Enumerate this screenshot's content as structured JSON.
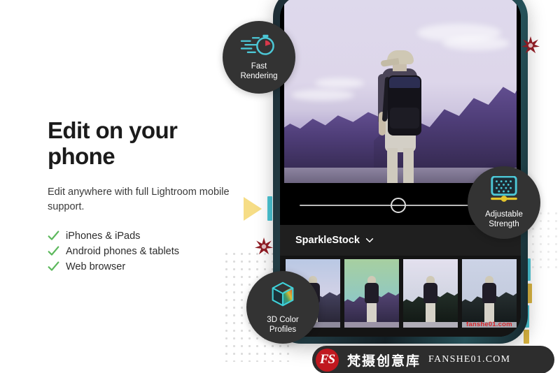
{
  "page": {
    "background_color": "#ffffff",
    "accent_teal": "#4cc7d6",
    "accent_yellow": "#f6dd86",
    "accent_red": "#8c1b23",
    "check_green": "#5cb85c",
    "badge_bg": "#333333"
  },
  "left_panel": {
    "headline": "Edit on your phone",
    "subhead": "Edit anywhere with full Lightroom mobile support.",
    "features": [
      {
        "icon": "check-icon",
        "label": "iPhones & iPads"
      },
      {
        "icon": "check-icon",
        "label": "Android phones & tablets"
      },
      {
        "icon": "check-icon",
        "label": "Web browser"
      }
    ]
  },
  "badges": [
    {
      "id": "fast-rendering",
      "icon": "stopwatch-speed-icon",
      "label": "Fast\nRendering"
    },
    {
      "id": "adjustable-strength",
      "icon": "grid-slider-icon",
      "label": "Adjustable\nStrength"
    },
    {
      "id": "3d-color-profiles",
      "icon": "color-cube-icon",
      "label": "3D Color\nProfiles"
    }
  ],
  "phone": {
    "photo": {
      "alt": "hiker-with-backpack-photo",
      "sky_color": "#ded9ec",
      "forest_color": "#4e3d77"
    },
    "slider": {
      "icon": "slider-handle-icon",
      "value_percent": 50
    },
    "preset_bar": {
      "title": "SparkleStock",
      "chevron_icon": "chevron-down-icon"
    },
    "thumbnails": [
      {
        "name": "preset-thumb-1",
        "sky": "#b9c8e4",
        "forest": "#3c3a52",
        "road": "#8e8a9c"
      },
      {
        "name": "preset-thumb-2",
        "sky": "#8fc8b0",
        "forest": "#3f3554",
        "road": "#9b93a6"
      },
      {
        "name": "preset-thumb-3",
        "sky": "#dcd8ea",
        "forest": "#1e2a25",
        "road": "#b1aeb8"
      },
      {
        "name": "preset-thumb-4",
        "sky": "#ccd3e6",
        "forest": "#232b2c",
        "road": "#a8a9b2"
      }
    ]
  },
  "decorations": {
    "triangle": "yellow-triangle",
    "teal_bars": "teal-bar",
    "yellow_bars": "yellow-bar",
    "stars": "red-starburst",
    "dot_grid": "dot-grid-pattern"
  },
  "watermark": {
    "logo_text": "FS",
    "brand_cn": "梵摄创意库",
    "url": "FANSHE01.COM",
    "small_url": "fanshe01.com"
  }
}
